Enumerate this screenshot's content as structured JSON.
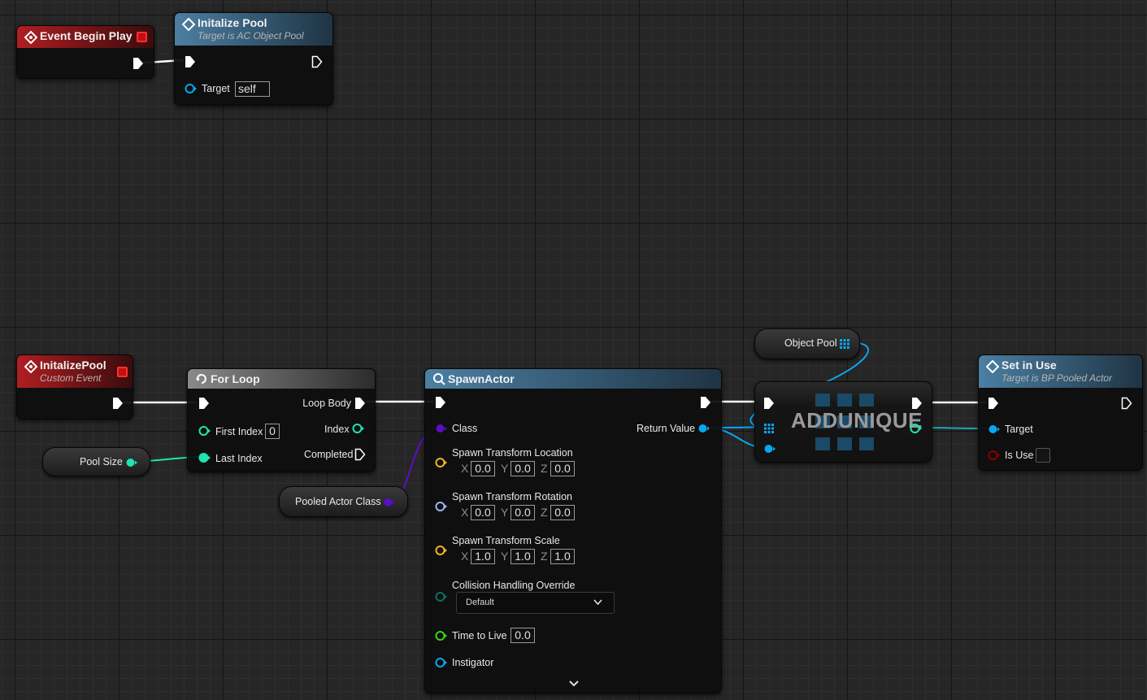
{
  "nodes": {
    "event_begin_play": {
      "title": "Event Begin Play"
    },
    "initalize_pool_call": {
      "title": "Initalize Pool",
      "subtitle": "Target is AC Object Pool",
      "target_label": "Target",
      "target_value": "self"
    },
    "initalize_pool_event": {
      "title": "InitalizePool",
      "subtitle": "Custom Event"
    },
    "for_loop": {
      "title": "For Loop",
      "loop_body": "Loop Body",
      "first_index": "First Index",
      "first_index_value": "0",
      "index": "Index",
      "last_index": "Last Index",
      "completed": "Completed"
    },
    "pool_size": {
      "label": "Pool Size"
    },
    "pooled_actor_class": {
      "label": "Pooled Actor Class"
    },
    "spawn_actor": {
      "title": "SpawnActor",
      "class_label": "Class",
      "return_value": "Return Value",
      "location_label": "Spawn Transform Location",
      "location": {
        "x": "0.0",
        "y": "0.0",
        "z": "0.0"
      },
      "rotation_label": "Spawn Transform Rotation",
      "rotation": {
        "x": "0.0",
        "y": "0.0",
        "z": "0.0"
      },
      "scale_label": "Spawn Transform Scale",
      "scale": {
        "x": "1.0",
        "y": "1.0",
        "z": "1.0"
      },
      "collision_label": "Collision Handling Override",
      "collision_value": "Default",
      "time_to_live_label": "Time to Live",
      "time_to_live_value": "0.0",
      "instigator_label": "Instigator",
      "axis_x": "X",
      "axis_y": "Y",
      "axis_z": "Z"
    },
    "object_pool": {
      "label": "Object Pool"
    },
    "add_unique": {
      "title": "ADDUNIQUE"
    },
    "set_in_use": {
      "title": "Set in Use",
      "subtitle": "Target is BP Pooled Actor",
      "target_label": "Target",
      "is_use_label": "Is Use"
    }
  },
  "colors": {
    "exec": "#ffffff",
    "integer": "#1fe3b0",
    "object": "#0aa6f0",
    "class": "#5a0ec8",
    "vector": "#f5b321",
    "rotator": "#9fb4f6",
    "enum": "#0b6e62",
    "float": "#39d613",
    "bool": "#8a0000",
    "event_header": "#b01f22",
    "function_header": "#4c7fa3",
    "macro_header": "#8a8a8a"
  }
}
